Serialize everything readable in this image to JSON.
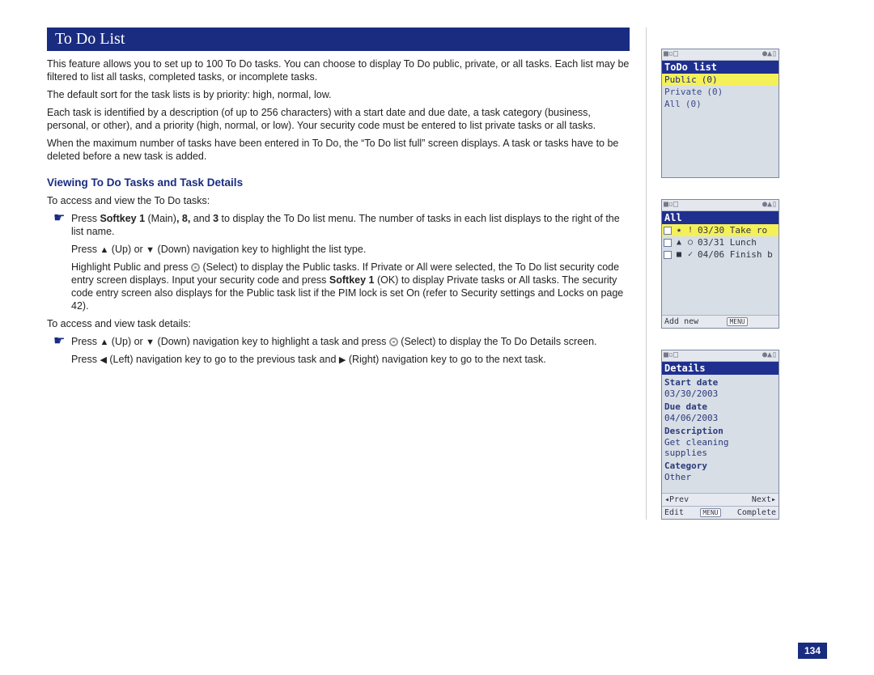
{
  "page_number": "134",
  "title": "To Do List",
  "paragraphs": {
    "p1": "This feature allows you to set up to 100 To Do tasks. You can choose to display To Do public, private, or all tasks. Each list may be filtered to list all tasks, completed tasks, or incomplete tasks.",
    "p2": "The default sort for the task lists is by priority: high, normal, low.",
    "p3": "Each task is identified by a description (of up to 256 characters) with a start date and due date, a task category (business, personal, or other), and a priority (high, normal, or low). Your security code must be entered to list private tasks or all tasks.",
    "p4": "When the maximum number of tasks have been entered in To Do, the “To Do list full” screen displays. A task or tasks have to be deleted before a new task is added."
  },
  "subhead": "Viewing To Do Tasks and Task Details",
  "access_view_intro": "To access and view the To Do tasks:",
  "step1": {
    "prefix": "Press ",
    "sk1": "Softkey 1",
    "main": " (Main)",
    "comma8": ", 8,",
    "and3": " and ",
    "three": "3",
    "rest": " to display the To Do list menu. The number of tasks in each list displays to the right of the list name."
  },
  "step1b": {
    "press": "Press ",
    "up": " (Up) or ",
    "down": " (Down) navigation key to highlight the list type."
  },
  "step1c": {
    "t1": "Highlight Public and press ",
    "sel": " (Select) to display the Public tasks. If Private or All were selected, the To Do list security code entry screen displays. Input your security code and press ",
    "sk1": "Softkey 1",
    "t2": " (OK) to display Private tasks or All tasks. The security code entry screen also displays for the Public task list if the PIM lock is set On (refer to Security settings and Locks on page 42)."
  },
  "access_details_intro": "To access and view task details:",
  "step2a": {
    "press": "Press ",
    "up": " (Up) or ",
    "down": " (Down) navigation key to highlight a task and press ",
    "sel": " (Select) to display the To Do Details screen."
  },
  "step2b": {
    "press": "Press ",
    "left": " (Left) navigation key to go to the previous task and ",
    "right": " (Right) navigation key to go to the next task."
  },
  "phone1": {
    "header": "ToDo list",
    "rows": [
      {
        "label": "Public",
        "count": "(0)"
      },
      {
        "label": "Private",
        "count": "(0)"
      },
      {
        "label": "All",
        "count": "(0)"
      }
    ]
  },
  "phone2": {
    "header": "All",
    "items": [
      {
        "icon1": "★",
        "icon2": "!",
        "text": "03/30 Take ro"
      },
      {
        "icon1": "▲",
        "icon2": "○",
        "text": "03/31 Lunch"
      },
      {
        "icon1": "■",
        "icon2": "✓",
        "text": "04/06 Finish b"
      }
    ],
    "soft_left": "Add new",
    "soft_menu": "MENU"
  },
  "phone3": {
    "header": "Details",
    "fields": {
      "start_lbl": "Start date",
      "start_val": "03/30/2003",
      "due_lbl": "Due date",
      "due_val": "04/06/2003",
      "desc_lbl": "Description",
      "desc_val": "Get cleaning supplies",
      "cat_lbl": "Category",
      "cat_val": "Other"
    },
    "soft": {
      "prev": "◂Prev",
      "next": "Next▸",
      "edit": "Edit",
      "menu": "MENU",
      "complete": "Complete"
    }
  },
  "status_left": "■▫□",
  "status_right": "●▲▯"
}
